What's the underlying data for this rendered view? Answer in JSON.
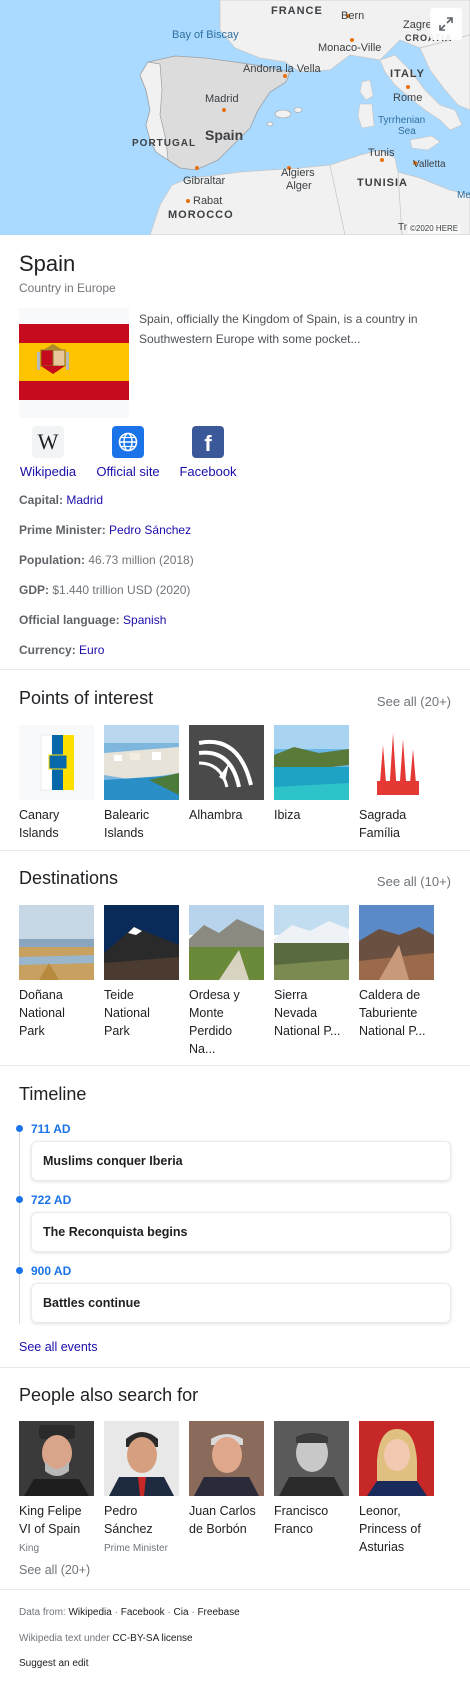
{
  "map": {
    "labels": {
      "france": "FRANCE",
      "bern": "Bern",
      "zagreb": "Zagre",
      "croatia": "CROATIA",
      "bay_of_biscay": "Bay of Biscay",
      "monaco": "Monaco-Ville",
      "andorra": "Andorra la Vella",
      "italy": "ITALY",
      "madrid": "Madrid",
      "rome": "Rome",
      "portugal": "PORTUGAL",
      "spain": "Spain",
      "tyrrhenian": "Tyrrhenian",
      "sea": "Sea",
      "tunis": "Tunis",
      "valletta": "Valletta",
      "gibraltar": "Gibraltar",
      "algiers": "Algiers",
      "alger": "Alger",
      "tunisia": "TUNISIA",
      "rabat": "Rabat",
      "morocco": "MOROCCO",
      "me": "Me",
      "tr": "Tr",
      "attribution": "©2020 HERE"
    },
    "colors": {
      "water": "#aadaff",
      "land": "#f1f1f1",
      "highlight": "#dcdcdc",
      "border": "#9aa0a6"
    }
  },
  "entity": {
    "title": "Spain",
    "subtitle": "Country in Europe",
    "description": "Spain, officially the Kingdom of Spain, is a country in Southwestern Europe with some pocket...",
    "flag_colors": {
      "red": "#c60b1e",
      "yellow": "#ffc400"
    }
  },
  "links": [
    {
      "label": "Wikipedia",
      "icon": "wikipedia-icon"
    },
    {
      "label": "Official site",
      "icon": "globe-icon"
    },
    {
      "label": "Facebook",
      "icon": "facebook-icon"
    }
  ],
  "facts": [
    {
      "key": "Capital: ",
      "value": "Madrid",
      "link": true
    },
    {
      "key": "Prime Minister: ",
      "value": "Pedro Sánchez",
      "link": true
    },
    {
      "key": "Population: ",
      "value": "46.73 million (2018)",
      "link": false
    },
    {
      "key": "GDP: ",
      "value": "$1.440 trillion USD (2020)",
      "link": false
    },
    {
      "key": "Official language: ",
      "value": "Spanish",
      "link": true
    },
    {
      "key": "Currency: ",
      "value": "Euro",
      "link": true
    }
  ],
  "points_of_interest": {
    "title": "Points of interest",
    "see_all": "See all (20+)",
    "items": [
      {
        "line1": "Canary",
        "line2": "Islands"
      },
      {
        "line1": "Balearic",
        "line2": "Islands"
      },
      {
        "line1": "Alhambra",
        "line2": ""
      },
      {
        "line1": "Ibiza",
        "line2": ""
      },
      {
        "line1": "Sagrada",
        "line2": "Família"
      }
    ]
  },
  "destinations": {
    "title": "Destinations",
    "see_all": "See all (10+)",
    "items": [
      {
        "line1": "Doñana",
        "line2": "National",
        "line3": "Park",
        "line4": ""
      },
      {
        "line1": "Teide",
        "line2": "National",
        "line3": "Park",
        "line4": ""
      },
      {
        "line1": "Ordesa y",
        "line2": "Monte",
        "line3": "Perdido",
        "line4": "Na..."
      },
      {
        "line1": "Sierra",
        "line2": "Nevada",
        "line3": "National P...",
        "line4": ""
      },
      {
        "line1": "Caldera de",
        "line2": "Taburiente",
        "line3": "National P...",
        "line4": ""
      }
    ]
  },
  "timeline": {
    "title": "Timeline",
    "events": [
      {
        "date": "711 AD",
        "text": "Muslims conquer Iberia"
      },
      {
        "date": "722 AD",
        "text": "The Reconquista begins"
      },
      {
        "date": "900 AD",
        "text": "Battles continue"
      }
    ],
    "see_all": "See all events"
  },
  "people": {
    "title": "People also search for",
    "items": [
      {
        "line1": "King Felipe",
        "line2": "VI of Spain",
        "line3": "",
        "sub": "King"
      },
      {
        "line1": "Pedro",
        "line2": "Sánchez",
        "line3": "",
        "sub": "Prime Minister"
      },
      {
        "line1": "Juan Carlos",
        "line2": "de Borbón",
        "line3": "",
        "sub": ""
      },
      {
        "line1": "Francisco",
        "line2": "Franco",
        "line3": "",
        "sub": ""
      },
      {
        "line1": "Leonor,",
        "line2": "Princess of",
        "line3": "Asturias",
        "sub": ""
      }
    ],
    "see_all": "See all (20+)"
  },
  "footer": {
    "data_from": "Data from: ",
    "sources": [
      "Wikipedia",
      "Facebook",
      "Cia",
      "Freebase"
    ],
    "sep": " · ",
    "license_prefix": "Wikipedia text under ",
    "license": "CC-BY-SA license",
    "suggest": "Suggest an edit"
  }
}
